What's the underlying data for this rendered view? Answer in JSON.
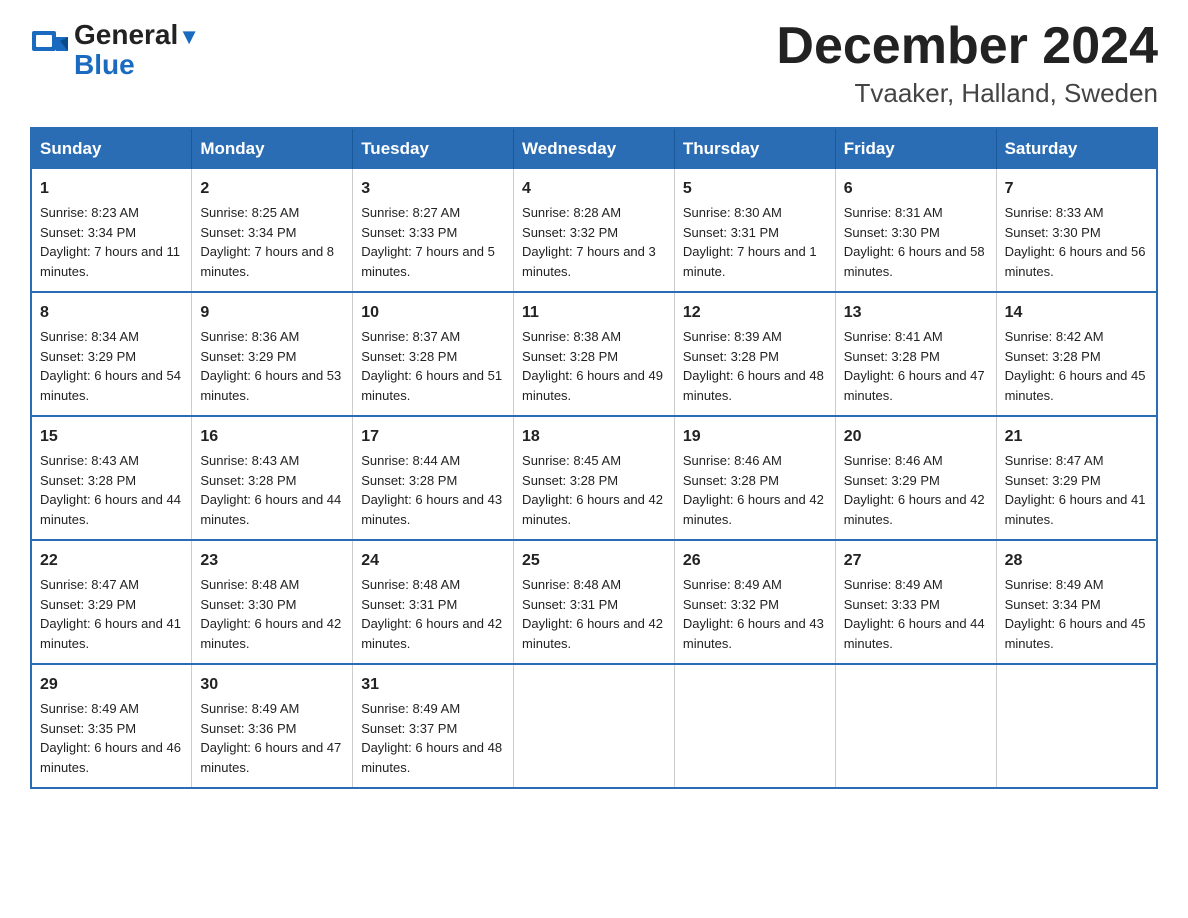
{
  "header": {
    "logo_general": "General",
    "logo_blue": "Blue",
    "month_title": "December 2024",
    "location": "Tvaaker, Halland, Sweden"
  },
  "days_of_week": [
    "Sunday",
    "Monday",
    "Tuesday",
    "Wednesday",
    "Thursday",
    "Friday",
    "Saturday"
  ],
  "weeks": [
    [
      {
        "day": "1",
        "sunrise": "8:23 AM",
        "sunset": "3:34 PM",
        "daylight": "7 hours and 11 minutes."
      },
      {
        "day": "2",
        "sunrise": "8:25 AM",
        "sunset": "3:34 PM",
        "daylight": "7 hours and 8 minutes."
      },
      {
        "day": "3",
        "sunrise": "8:27 AM",
        "sunset": "3:33 PM",
        "daylight": "7 hours and 5 minutes."
      },
      {
        "day": "4",
        "sunrise": "8:28 AM",
        "sunset": "3:32 PM",
        "daylight": "7 hours and 3 minutes."
      },
      {
        "day": "5",
        "sunrise": "8:30 AM",
        "sunset": "3:31 PM",
        "daylight": "7 hours and 1 minute."
      },
      {
        "day": "6",
        "sunrise": "8:31 AM",
        "sunset": "3:30 PM",
        "daylight": "6 hours and 58 minutes."
      },
      {
        "day": "7",
        "sunrise": "8:33 AM",
        "sunset": "3:30 PM",
        "daylight": "6 hours and 56 minutes."
      }
    ],
    [
      {
        "day": "8",
        "sunrise": "8:34 AM",
        "sunset": "3:29 PM",
        "daylight": "6 hours and 54 minutes."
      },
      {
        "day": "9",
        "sunrise": "8:36 AM",
        "sunset": "3:29 PM",
        "daylight": "6 hours and 53 minutes."
      },
      {
        "day": "10",
        "sunrise": "8:37 AM",
        "sunset": "3:28 PM",
        "daylight": "6 hours and 51 minutes."
      },
      {
        "day": "11",
        "sunrise": "8:38 AM",
        "sunset": "3:28 PM",
        "daylight": "6 hours and 49 minutes."
      },
      {
        "day": "12",
        "sunrise": "8:39 AM",
        "sunset": "3:28 PM",
        "daylight": "6 hours and 48 minutes."
      },
      {
        "day": "13",
        "sunrise": "8:41 AM",
        "sunset": "3:28 PM",
        "daylight": "6 hours and 47 minutes."
      },
      {
        "day": "14",
        "sunrise": "8:42 AM",
        "sunset": "3:28 PM",
        "daylight": "6 hours and 45 minutes."
      }
    ],
    [
      {
        "day": "15",
        "sunrise": "8:43 AM",
        "sunset": "3:28 PM",
        "daylight": "6 hours and 44 minutes."
      },
      {
        "day": "16",
        "sunrise": "8:43 AM",
        "sunset": "3:28 PM",
        "daylight": "6 hours and 44 minutes."
      },
      {
        "day": "17",
        "sunrise": "8:44 AM",
        "sunset": "3:28 PM",
        "daylight": "6 hours and 43 minutes."
      },
      {
        "day": "18",
        "sunrise": "8:45 AM",
        "sunset": "3:28 PM",
        "daylight": "6 hours and 42 minutes."
      },
      {
        "day": "19",
        "sunrise": "8:46 AM",
        "sunset": "3:28 PM",
        "daylight": "6 hours and 42 minutes."
      },
      {
        "day": "20",
        "sunrise": "8:46 AM",
        "sunset": "3:29 PM",
        "daylight": "6 hours and 42 minutes."
      },
      {
        "day": "21",
        "sunrise": "8:47 AM",
        "sunset": "3:29 PM",
        "daylight": "6 hours and 41 minutes."
      }
    ],
    [
      {
        "day": "22",
        "sunrise": "8:47 AM",
        "sunset": "3:29 PM",
        "daylight": "6 hours and 41 minutes."
      },
      {
        "day": "23",
        "sunrise": "8:48 AM",
        "sunset": "3:30 PM",
        "daylight": "6 hours and 42 minutes."
      },
      {
        "day": "24",
        "sunrise": "8:48 AM",
        "sunset": "3:31 PM",
        "daylight": "6 hours and 42 minutes."
      },
      {
        "day": "25",
        "sunrise": "8:48 AM",
        "sunset": "3:31 PM",
        "daylight": "6 hours and 42 minutes."
      },
      {
        "day": "26",
        "sunrise": "8:49 AM",
        "sunset": "3:32 PM",
        "daylight": "6 hours and 43 minutes."
      },
      {
        "day": "27",
        "sunrise": "8:49 AM",
        "sunset": "3:33 PM",
        "daylight": "6 hours and 44 minutes."
      },
      {
        "day": "28",
        "sunrise": "8:49 AM",
        "sunset": "3:34 PM",
        "daylight": "6 hours and 45 minutes."
      }
    ],
    [
      {
        "day": "29",
        "sunrise": "8:49 AM",
        "sunset": "3:35 PM",
        "daylight": "6 hours and 46 minutes."
      },
      {
        "day": "30",
        "sunrise": "8:49 AM",
        "sunset": "3:36 PM",
        "daylight": "6 hours and 47 minutes."
      },
      {
        "day": "31",
        "sunrise": "8:49 AM",
        "sunset": "3:37 PM",
        "daylight": "6 hours and 48 minutes."
      },
      null,
      null,
      null,
      null
    ]
  ],
  "cell_labels": {
    "sunrise": "Sunrise:",
    "sunset": "Sunset:",
    "daylight": "Daylight:"
  }
}
